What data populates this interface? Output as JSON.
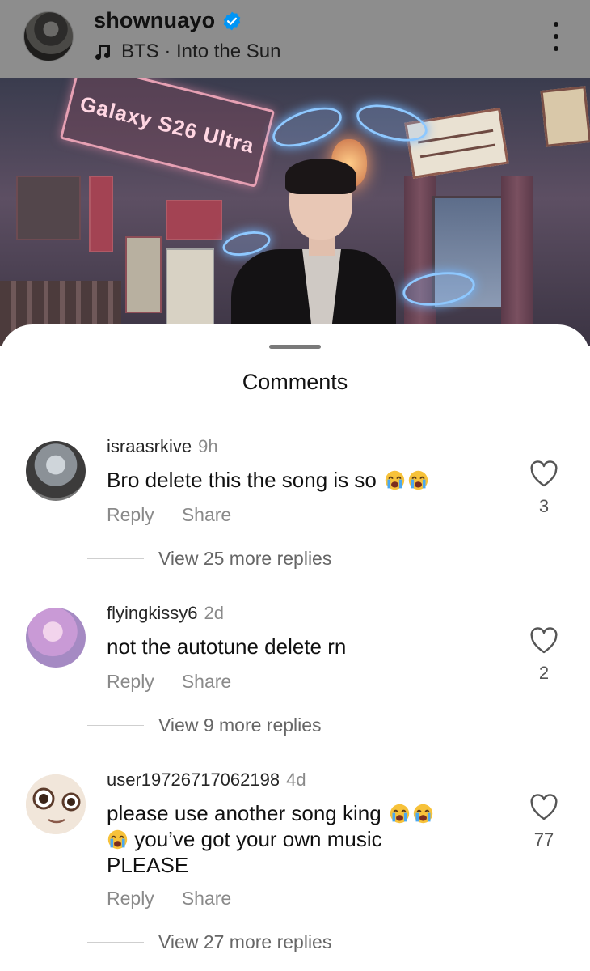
{
  "post": {
    "username": "shownuayo",
    "music": "BTS · Into the Sun",
    "video_sign": "Galaxy S26 Ultra"
  },
  "sheet": {
    "title": "Comments"
  },
  "comments": [
    {
      "username": "israasrkive",
      "time": "9h",
      "text": "Bro delete this the song is so",
      "emojis": 2,
      "reply_label": "Reply",
      "share_label": "Share",
      "likes": "3",
      "view_replies": "View 25 more replies"
    },
    {
      "username": "flyingkissy6",
      "time": "2d",
      "text": "not the autotune delete rn",
      "emojis": 0,
      "reply_label": "Reply",
      "share_label": "Share",
      "likes": "2",
      "view_replies": "View 9 more replies"
    },
    {
      "username": "user19726717062198",
      "time": "4d",
      "text_line1": "please use another song king",
      "text_line2": "you’ve got your own music",
      "text_line3": "PLEASE",
      "reply_label": "Reply",
      "share_label": "Share",
      "likes": "77",
      "view_replies": "View 27 more replies"
    }
  ],
  "icons": {
    "verified": "verified-badge-icon",
    "music": "music-note-icon",
    "more": "more-vertical-icon",
    "heart": "heart-outline-icon",
    "emoji": "loudly-crying-face-emoji"
  },
  "colors": {
    "verified_blue": "#0095f6",
    "secondary_text": "#8a8a8a"
  }
}
